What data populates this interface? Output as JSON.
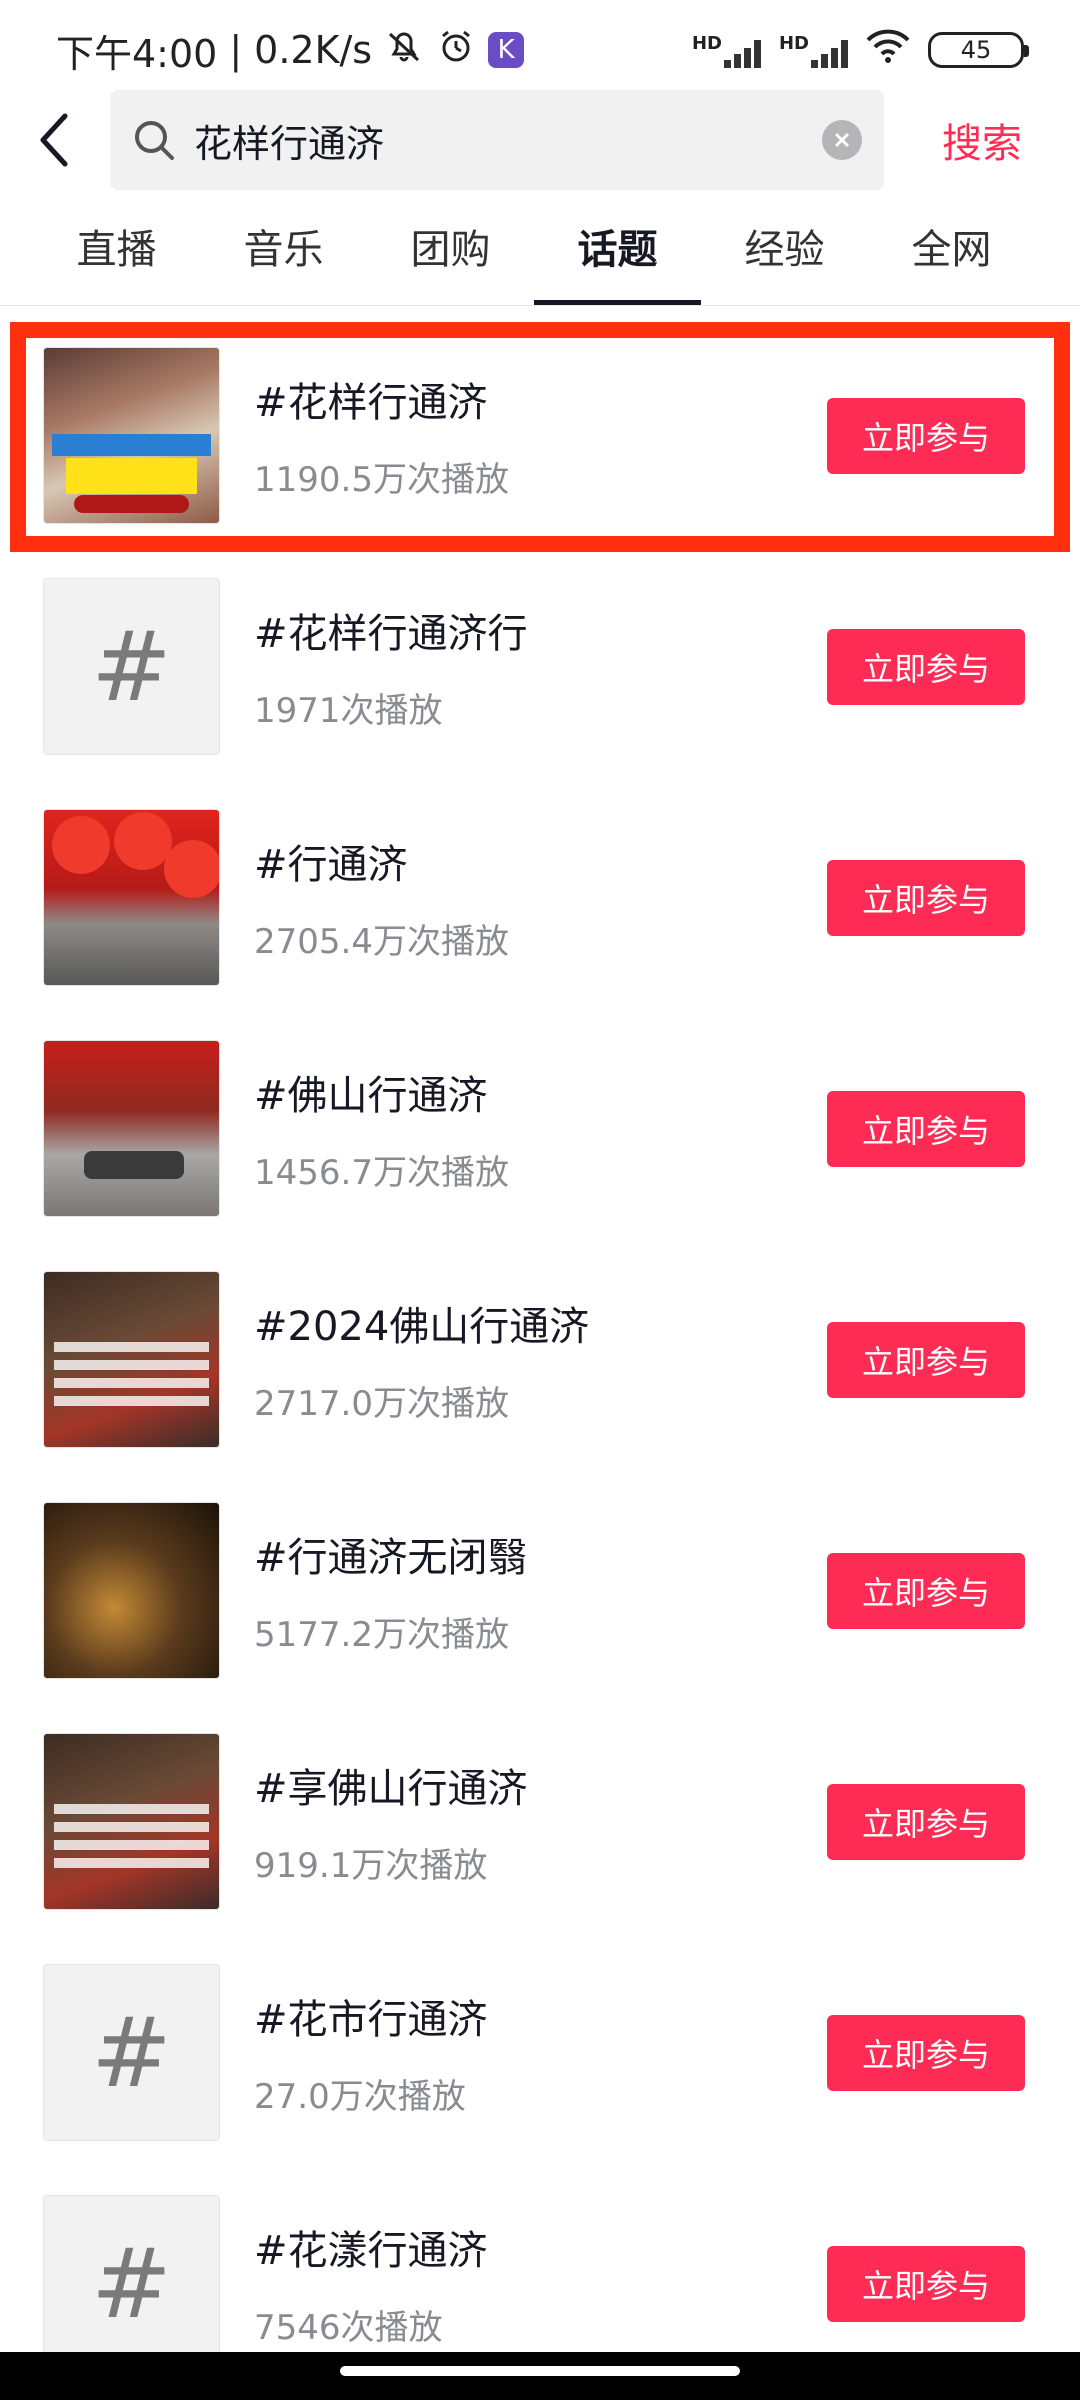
{
  "status_bar": {
    "time": "下午4:00",
    "speed": "0.2K/s",
    "sep": "|",
    "hd1": "HD",
    "hd2": "HD",
    "battery": "45",
    "k_app": "K"
  },
  "search": {
    "query": "花样行通济",
    "submit_label": "搜索"
  },
  "tabs": [
    "直播",
    "音乐",
    "团购",
    "话题",
    "经验",
    "全网"
  ],
  "active_tab_index": 3,
  "hash_glyph": "#",
  "topics": [
    {
      "title": "#花样行通济",
      "plays": "1190.5万次播放",
      "button": "立即参与",
      "thumb": "photo-event-banner",
      "highlighted": true
    },
    {
      "title": "#花样行通济行",
      "plays": "1971次播放",
      "button": "立即参与",
      "thumb": "hash-placeholder"
    },
    {
      "title": "#行通济",
      "plays": "2705.4万次播放",
      "button": "立即参与",
      "thumb": "photo-lanterns"
    },
    {
      "title": "#佛山行通济",
      "plays": "1456.7万次播放",
      "button": "立即参与",
      "thumb": "photo-street"
    },
    {
      "title": "#2024佛山行通济",
      "plays": "2717.0万次播放",
      "button": "立即参与",
      "thumb": "photo-crowd-text"
    },
    {
      "title": "#行通济无闭翳",
      "plays": "5177.2万次播放",
      "button": "立即参与",
      "thumb": "photo-night-crowd"
    },
    {
      "title": "#享佛山行通济",
      "plays": "919.1万次播放",
      "button": "立即参与",
      "thumb": "photo-crowd-text"
    },
    {
      "title": "#花市行通济",
      "plays": "27.0万次播放",
      "button": "立即参与",
      "thumb": "hash-placeholder"
    },
    {
      "title": "#花漾行通济",
      "plays": "7546次播放",
      "button": "立即参与",
      "thumb": "hash-placeholder"
    }
  ],
  "colors": {
    "accent": "#fe2c55",
    "highlight_border": "#ff2f0f",
    "text_primary": "#161823",
    "text_secondary": "#8a8b91"
  }
}
